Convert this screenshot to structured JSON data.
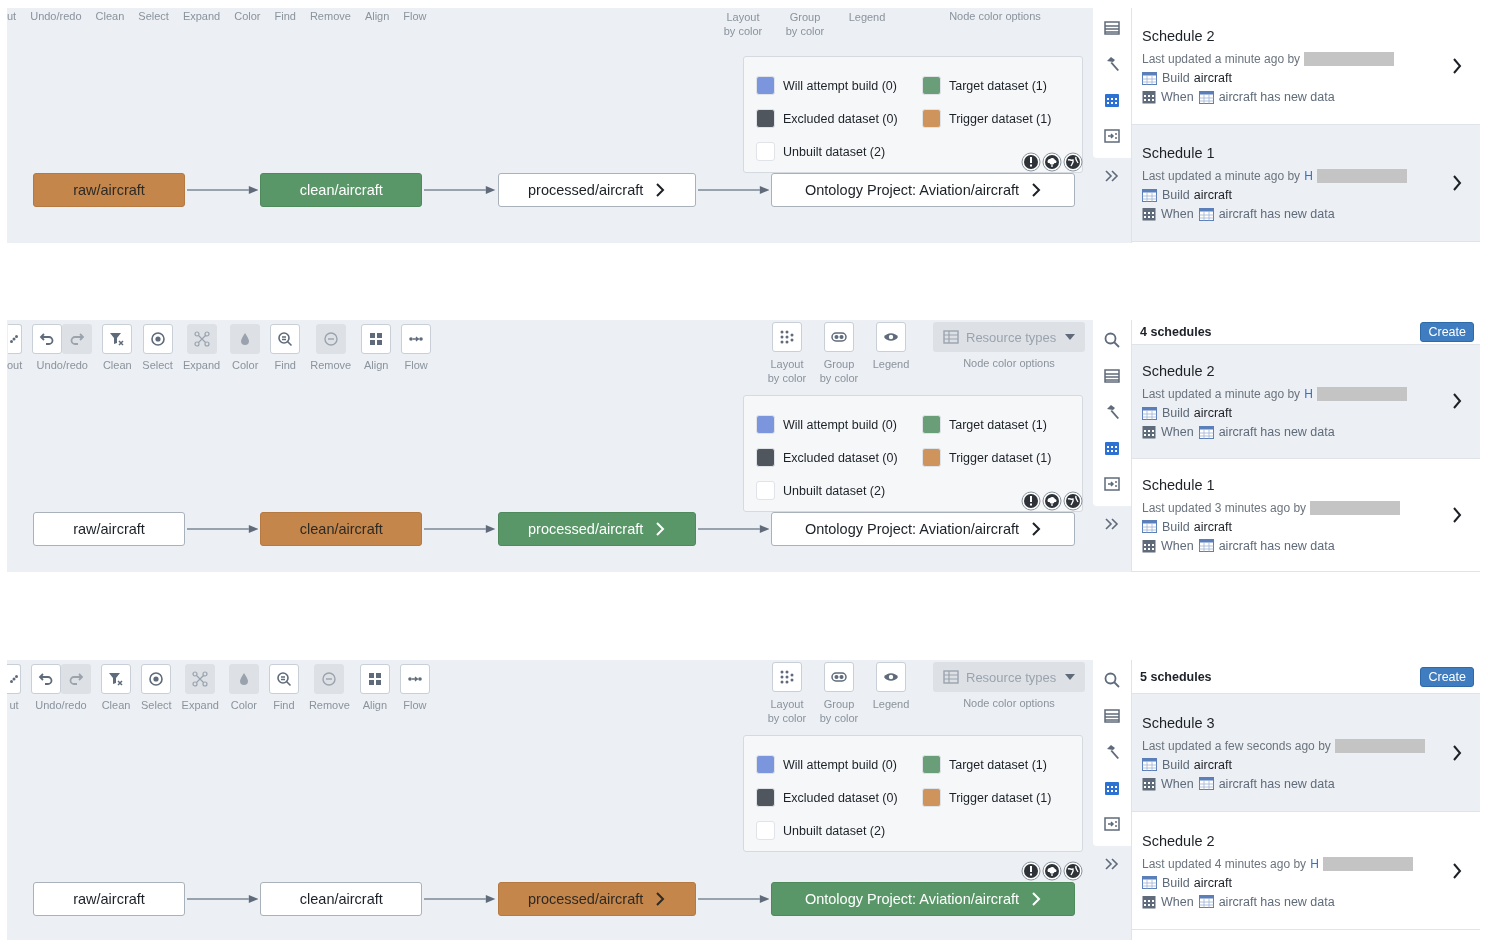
{
  "panels": [
    {
      "tools": [
        {
          "label": "ut"
        },
        {
          "label": "Undo/redo"
        },
        {
          "label": "Clean"
        },
        {
          "label": "Select"
        },
        {
          "label": "Expand"
        },
        {
          "label": "Color"
        },
        {
          "label": "Find"
        },
        {
          "label": "Remove"
        },
        {
          "label": "Align"
        },
        {
          "label": "Flow"
        }
      ],
      "view_tools": [
        {
          "label": "Layout by color"
        },
        {
          "label": "Group by color"
        },
        {
          "label": "Legend"
        }
      ],
      "node_color": {
        "label": "Node color options"
      },
      "legend": [
        {
          "label": "Will attempt build (0)",
          "color": "#7b96dc"
        },
        {
          "label": "Target dataset (1)",
          "color": "#6a9e78"
        },
        {
          "label": "Excluded dataset (0)",
          "color": "#4f565e"
        },
        {
          "label": "Trigger dataset (1)",
          "color": "#cf945c"
        },
        {
          "label": "Unbuilt dataset (2)",
          "color": "#ffffff"
        }
      ],
      "nodes": [
        {
          "label": "raw/aircraft",
          "kind": "trigger",
          "expandable": false
        },
        {
          "label": "clean/aircraft",
          "kind": "target",
          "expandable": false
        },
        {
          "label": "processed/aircraft",
          "kind": "plain",
          "expandable": true
        },
        {
          "label": "Ontology Project: Aviation/aircraft",
          "kind": "plain",
          "expandable": true
        }
      ],
      "rail": [
        {
          "kind": "list",
          "selected": false
        },
        {
          "kind": "hammer",
          "selected": false
        },
        {
          "kind": "calendar",
          "selected": true
        },
        {
          "kind": "form",
          "selected": false
        }
      ],
      "schedules": [
        {
          "title": "Schedule 2",
          "updated": "Last updated a minute ago by",
          "build_label": "Build",
          "build_target": "aircraft",
          "when_label": "When",
          "when_target": "aircraft has new data",
          "selected": false
        },
        {
          "title": "Schedule 1",
          "updated": "Last updated a minute ago by",
          "user": "H",
          "build_label": "Build",
          "build_target": "aircraft",
          "when_label": "When",
          "when_target": "aircraft has new data",
          "selected": true
        }
      ]
    },
    {
      "tools": [
        {
          "label": "out",
          "buttons": [
            {
              "kind": "layout",
              "disabled": false
            }
          ]
        },
        {
          "label": "Undo/redo",
          "buttons": [
            {
              "kind": "undo",
              "disabled": false
            },
            {
              "kind": "redo",
              "disabled": true
            }
          ]
        },
        {
          "label": "Clean",
          "buttons": [
            {
              "kind": "clean",
              "disabled": false
            }
          ]
        },
        {
          "label": "Select",
          "buttons": [
            {
              "kind": "select",
              "disabled": false
            }
          ]
        },
        {
          "label": "Expand",
          "buttons": [
            {
              "kind": "expand",
              "disabled": true
            }
          ]
        },
        {
          "label": "Color",
          "buttons": [
            {
              "kind": "color",
              "disabled": true
            }
          ]
        },
        {
          "label": "Find",
          "buttons": [
            {
              "kind": "find",
              "disabled": false
            }
          ]
        },
        {
          "label": "Remove",
          "buttons": [
            {
              "kind": "remove",
              "disabled": true
            }
          ]
        },
        {
          "label": "Align",
          "buttons": [
            {
              "kind": "align",
              "disabled": false
            }
          ]
        },
        {
          "label": "Flow",
          "buttons": [
            {
              "kind": "flow",
              "disabled": false
            }
          ]
        }
      ],
      "view_tools": [
        {
          "label": "Layout by color",
          "kind": "dots"
        },
        {
          "label": "Group by color",
          "kind": "group"
        },
        {
          "label": "Legend",
          "kind": "eye"
        }
      ],
      "node_color": {
        "label": "Node color options",
        "dropdown": "Resource types"
      },
      "legend": [
        {
          "label": "Will attempt build (0)",
          "color": "#7b96dc"
        },
        {
          "label": "Target dataset (1)",
          "color": "#6a9e78"
        },
        {
          "label": "Excluded dataset (0)",
          "color": "#4f565e"
        },
        {
          "label": "Trigger dataset (1)",
          "color": "#cf945c"
        },
        {
          "label": "Unbuilt dataset (2)",
          "color": "#ffffff"
        }
      ],
      "nodes": [
        {
          "label": "raw/aircraft",
          "kind": "plain",
          "expandable": false
        },
        {
          "label": "clean/aircraft",
          "kind": "trigger",
          "expandable": false
        },
        {
          "label": "processed/aircraft",
          "kind": "target",
          "expandable": true
        },
        {
          "label": "Ontology Project: Aviation/aircraft",
          "kind": "plain",
          "expandable": true
        }
      ],
      "rail": [
        {
          "kind": "search",
          "selected": false
        },
        {
          "kind": "list",
          "selected": false
        },
        {
          "kind": "hammer",
          "selected": false
        },
        {
          "kind": "calendar",
          "selected": true
        },
        {
          "kind": "form",
          "selected": false
        }
      ],
      "header": {
        "count": "4 schedules",
        "button": "Create"
      },
      "schedules": [
        {
          "title": "Schedule 2",
          "updated": "Last updated a minute ago by",
          "user": "H",
          "build_label": "Build",
          "build_target": "aircraft",
          "when_label": "When",
          "when_target": "aircraft has new data",
          "selected": true
        },
        {
          "title": "Schedule 1",
          "updated": "Last updated 3 minutes ago by",
          "build_label": "Build",
          "build_target": "aircraft",
          "when_label": "When",
          "when_target": "aircraft has new data",
          "selected": false
        }
      ]
    },
    {
      "tools": [
        {
          "label": "ut",
          "buttons": [
            {
              "kind": "layout",
              "disabled": false
            }
          ]
        },
        {
          "label": "Undo/redo",
          "buttons": [
            {
              "kind": "undo",
              "disabled": false
            },
            {
              "kind": "redo",
              "disabled": true
            }
          ]
        },
        {
          "label": "Clean",
          "buttons": [
            {
              "kind": "clean",
              "disabled": false
            }
          ]
        },
        {
          "label": "Select",
          "buttons": [
            {
              "kind": "select",
              "disabled": false
            }
          ]
        },
        {
          "label": "Expand",
          "buttons": [
            {
              "kind": "expand",
              "disabled": true
            }
          ]
        },
        {
          "label": "Color",
          "buttons": [
            {
              "kind": "color",
              "disabled": true
            }
          ]
        },
        {
          "label": "Find",
          "buttons": [
            {
              "kind": "find",
              "disabled": false
            }
          ]
        },
        {
          "label": "Remove",
          "buttons": [
            {
              "kind": "remove",
              "disabled": true
            }
          ]
        },
        {
          "label": "Align",
          "buttons": [
            {
              "kind": "align",
              "disabled": false
            }
          ]
        },
        {
          "label": "Flow",
          "buttons": [
            {
              "kind": "flow",
              "disabled": false
            }
          ]
        }
      ],
      "view_tools": [
        {
          "label": "Layout by color",
          "kind": "dots"
        },
        {
          "label": "Group by color",
          "kind": "group"
        },
        {
          "label": "Legend",
          "kind": "eye"
        }
      ],
      "node_color": {
        "label": "Node color options",
        "dropdown": "Resource types"
      },
      "legend": [
        {
          "label": "Will attempt build (0)",
          "color": "#7b96dc"
        },
        {
          "label": "Target dataset (1)",
          "color": "#6a9e78"
        },
        {
          "label": "Excluded dataset (0)",
          "color": "#4f565e"
        },
        {
          "label": "Trigger dataset (1)",
          "color": "#cf945c"
        },
        {
          "label": "Unbuilt dataset (2)",
          "color": "#ffffff"
        }
      ],
      "nodes": [
        {
          "label": "raw/aircraft",
          "kind": "plain",
          "expandable": false
        },
        {
          "label": "clean/aircraft",
          "kind": "plain",
          "expandable": false
        },
        {
          "label": "processed/aircraft",
          "kind": "trigger",
          "expandable": true
        },
        {
          "label": "Ontology Project: Aviation/aircraft",
          "kind": "target",
          "expandable": true
        }
      ],
      "rail": [
        {
          "kind": "search",
          "selected": false
        },
        {
          "kind": "list",
          "selected": false
        },
        {
          "kind": "hammer",
          "selected": false
        },
        {
          "kind": "calendar",
          "selected": true
        },
        {
          "kind": "form",
          "selected": false
        }
      ],
      "header": {
        "count": "5 schedules",
        "button": "Create"
      },
      "schedules": [
        {
          "title": "Schedule 3",
          "updated": "Last updated a few seconds ago by",
          "build_label": "Build",
          "build_target": "aircraft",
          "when_label": "When",
          "when_target": "aircraft has new data",
          "selected": true
        },
        {
          "title": "Schedule 2",
          "updated": "Last updated 4 minutes ago by",
          "user": "H",
          "build_label": "Build",
          "build_target": "aircraft",
          "when_label": "When",
          "when_target": "aircraft has new data",
          "selected": false
        }
      ]
    }
  ]
}
